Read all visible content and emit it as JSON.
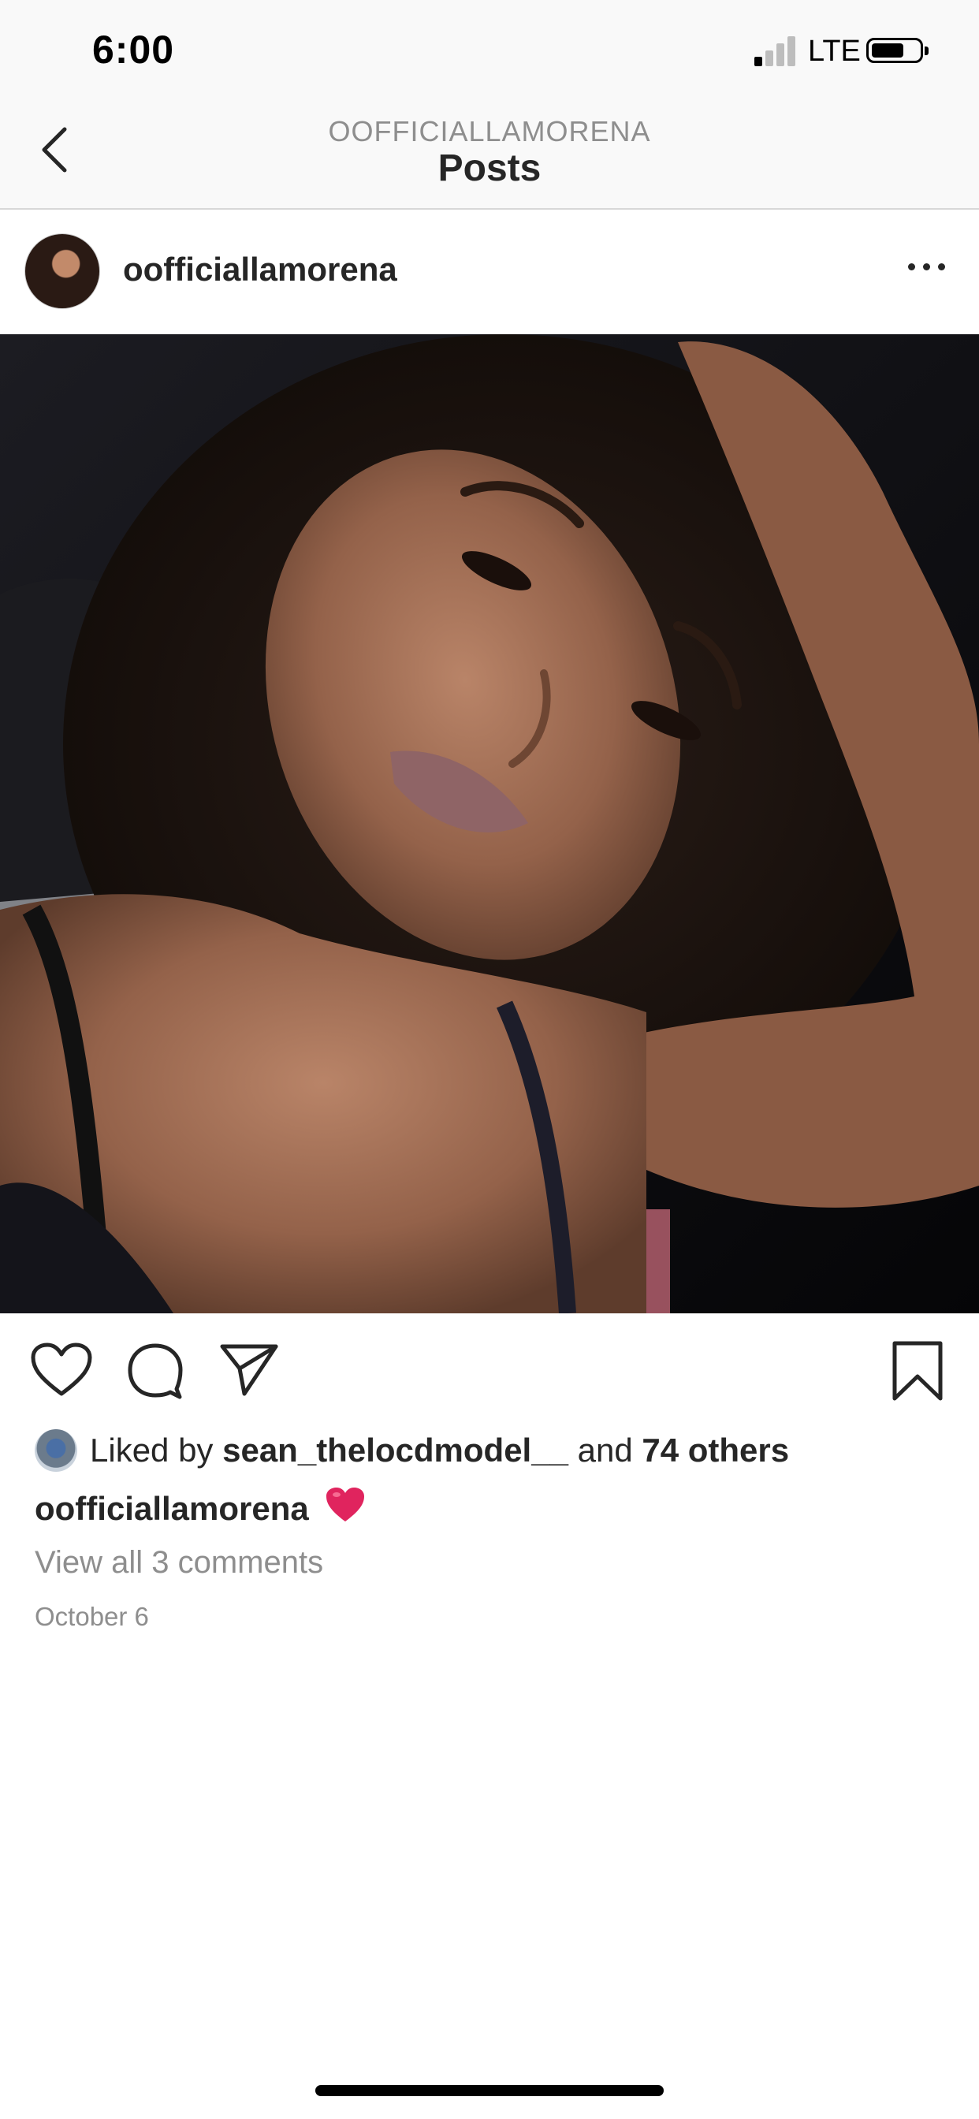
{
  "status_bar": {
    "time": "6:00",
    "network": "LTE",
    "signal_bars_filled": 1,
    "signal_bars_total": 4
  },
  "header": {
    "username": "OOFFICIALLAMORENA",
    "title": "Posts"
  },
  "post": {
    "username": "oofficiallamorena",
    "likes": {
      "prefix": "Liked by",
      "liker": "sean_thelocdmodel__",
      "connector": "and",
      "others": "74 others"
    },
    "caption": {
      "username": "oofficiallamorena",
      "text": "❤️"
    },
    "comments_link": "View all 3 comments",
    "date": "October 6"
  },
  "icons": {
    "back": "chevron-left-icon",
    "more": "more-horizontal-icon",
    "like": "heart-icon",
    "comment": "comment-icon",
    "share": "paper-plane-icon",
    "save": "bookmark-icon"
  },
  "colors": {
    "text_primary": "#262626",
    "text_secondary": "#8e8e8e",
    "header_bg": "#f9f9f9",
    "heart_emoji": "#e0245e"
  }
}
